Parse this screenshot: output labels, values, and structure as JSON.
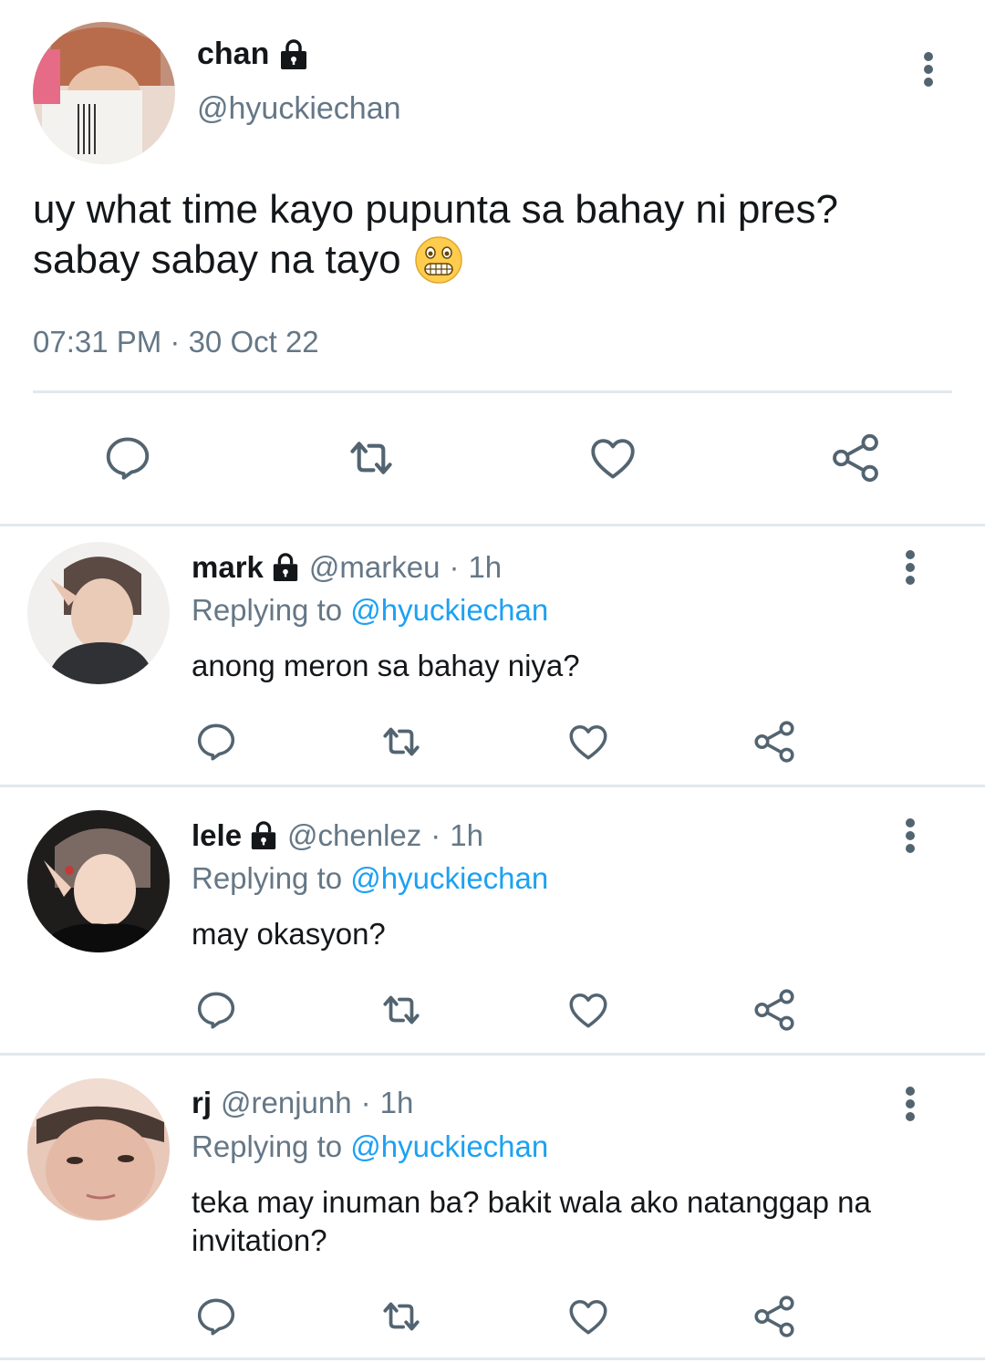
{
  "main_tweet": {
    "name": "chan",
    "handle": "@hyuckiechan",
    "text_line1": "uy what time kayo pupunta sa bahay ni pres?",
    "text_line2": "sabay sabay na tayo",
    "emoji": "grimacing-face",
    "timestamp": "07:31 PM · 30 Oct 22",
    "actions": [
      "reply-icon",
      "retweet-icon",
      "like-icon",
      "share-icon"
    ]
  },
  "replies": [
    {
      "name": "mark",
      "locked": true,
      "handle": "@markeu",
      "sep": "·",
      "time": "1h",
      "replying_prefix": "Replying to",
      "replying_to": "@hyuckiechan",
      "text": "anong meron sa bahay niya?"
    },
    {
      "name": "lele",
      "locked": true,
      "handle": "@chenlez",
      "sep": "·",
      "time": "1h",
      "replying_prefix": "Replying to",
      "replying_to": "@hyuckiechan",
      "text": "may okasyon?"
    },
    {
      "name": "rj",
      "locked": false,
      "handle": "@renjunh",
      "sep": "·",
      "time": "1h",
      "replying_prefix": "Replying to",
      "replying_to": "@hyuckiechan",
      "text": "teka may inuman ba? bakit wala ako natanggap na invitation?"
    }
  ],
  "colors": {
    "text": "#14171a",
    "secondary": "#657786",
    "link": "#1da1f2",
    "icon": "#536471",
    "divider": "#e1e8ed"
  }
}
